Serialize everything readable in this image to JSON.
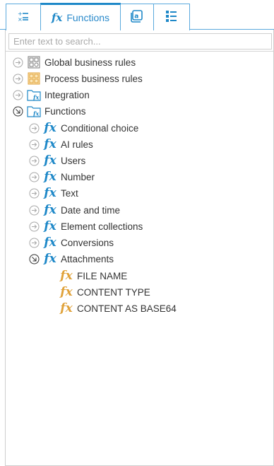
{
  "tabs": [
    {
      "icon": "variables-icon"
    },
    {
      "icon": "function-fx-icon",
      "label": "Functions"
    },
    {
      "icon": "at-box-icon"
    },
    {
      "icon": "list-icon"
    }
  ],
  "search": {
    "placeholder": "Enter text to search..."
  },
  "tree": {
    "global_business_rules": "Global business rules",
    "process_business_rules": "Process business rules",
    "integration": "Integration",
    "functions": "Functions",
    "conditional_choice": "Conditional choice",
    "ai_rules": "AI rules",
    "users": "Users",
    "number": "Number",
    "text": "Text",
    "date_and_time": "Date and time",
    "element_collections": "Element collections",
    "conversions": "Conversions",
    "attachments": "Attachments",
    "file_name": "FILE NAME",
    "content_type": "CONTENT TYPE",
    "content_as_base64": "CONTENT AS BASE64"
  },
  "icons": {
    "fx_glyph": "fx",
    "collapsed_toggle": "chevron-right-circle-icon",
    "expanded_toggle": "chevron-down-circle-icon"
  },
  "colors": {
    "accent": "#1e88c8",
    "function_item": "#e0a23a",
    "text": "#333333",
    "border": "#cfcfcf"
  }
}
